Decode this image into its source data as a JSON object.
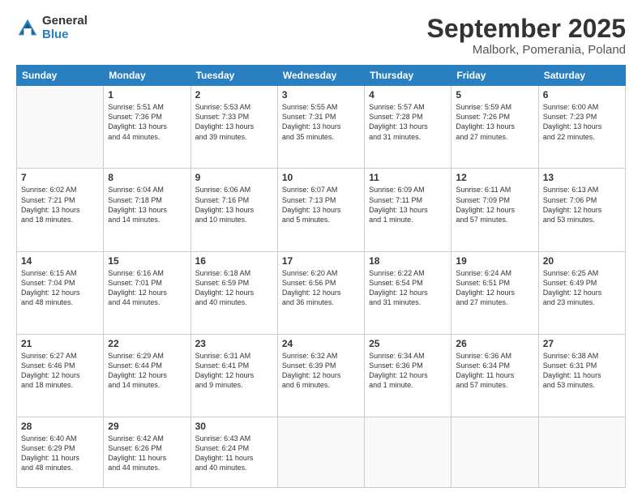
{
  "logo": {
    "general": "General",
    "blue": "Blue"
  },
  "header": {
    "month": "September 2025",
    "location": "Malbork, Pomerania, Poland"
  },
  "weekdays": [
    "Sunday",
    "Monday",
    "Tuesday",
    "Wednesday",
    "Thursday",
    "Friday",
    "Saturday"
  ],
  "weeks": [
    [
      {
        "day": "",
        "info": ""
      },
      {
        "day": "1",
        "info": "Sunrise: 5:51 AM\nSunset: 7:36 PM\nDaylight: 13 hours\nand 44 minutes."
      },
      {
        "day": "2",
        "info": "Sunrise: 5:53 AM\nSunset: 7:33 PM\nDaylight: 13 hours\nand 39 minutes."
      },
      {
        "day": "3",
        "info": "Sunrise: 5:55 AM\nSunset: 7:31 PM\nDaylight: 13 hours\nand 35 minutes."
      },
      {
        "day": "4",
        "info": "Sunrise: 5:57 AM\nSunset: 7:28 PM\nDaylight: 13 hours\nand 31 minutes."
      },
      {
        "day": "5",
        "info": "Sunrise: 5:59 AM\nSunset: 7:26 PM\nDaylight: 13 hours\nand 27 minutes."
      },
      {
        "day": "6",
        "info": "Sunrise: 6:00 AM\nSunset: 7:23 PM\nDaylight: 13 hours\nand 22 minutes."
      }
    ],
    [
      {
        "day": "7",
        "info": "Sunrise: 6:02 AM\nSunset: 7:21 PM\nDaylight: 13 hours\nand 18 minutes."
      },
      {
        "day": "8",
        "info": "Sunrise: 6:04 AM\nSunset: 7:18 PM\nDaylight: 13 hours\nand 14 minutes."
      },
      {
        "day": "9",
        "info": "Sunrise: 6:06 AM\nSunset: 7:16 PM\nDaylight: 13 hours\nand 10 minutes."
      },
      {
        "day": "10",
        "info": "Sunrise: 6:07 AM\nSunset: 7:13 PM\nDaylight: 13 hours\nand 5 minutes."
      },
      {
        "day": "11",
        "info": "Sunrise: 6:09 AM\nSunset: 7:11 PM\nDaylight: 13 hours\nand 1 minute."
      },
      {
        "day": "12",
        "info": "Sunrise: 6:11 AM\nSunset: 7:09 PM\nDaylight: 12 hours\nand 57 minutes."
      },
      {
        "day": "13",
        "info": "Sunrise: 6:13 AM\nSunset: 7:06 PM\nDaylight: 12 hours\nand 53 minutes."
      }
    ],
    [
      {
        "day": "14",
        "info": "Sunrise: 6:15 AM\nSunset: 7:04 PM\nDaylight: 12 hours\nand 48 minutes."
      },
      {
        "day": "15",
        "info": "Sunrise: 6:16 AM\nSunset: 7:01 PM\nDaylight: 12 hours\nand 44 minutes."
      },
      {
        "day": "16",
        "info": "Sunrise: 6:18 AM\nSunset: 6:59 PM\nDaylight: 12 hours\nand 40 minutes."
      },
      {
        "day": "17",
        "info": "Sunrise: 6:20 AM\nSunset: 6:56 PM\nDaylight: 12 hours\nand 36 minutes."
      },
      {
        "day": "18",
        "info": "Sunrise: 6:22 AM\nSunset: 6:54 PM\nDaylight: 12 hours\nand 31 minutes."
      },
      {
        "day": "19",
        "info": "Sunrise: 6:24 AM\nSunset: 6:51 PM\nDaylight: 12 hours\nand 27 minutes."
      },
      {
        "day": "20",
        "info": "Sunrise: 6:25 AM\nSunset: 6:49 PM\nDaylight: 12 hours\nand 23 minutes."
      }
    ],
    [
      {
        "day": "21",
        "info": "Sunrise: 6:27 AM\nSunset: 6:46 PM\nDaylight: 12 hours\nand 18 minutes."
      },
      {
        "day": "22",
        "info": "Sunrise: 6:29 AM\nSunset: 6:44 PM\nDaylight: 12 hours\nand 14 minutes."
      },
      {
        "day": "23",
        "info": "Sunrise: 6:31 AM\nSunset: 6:41 PM\nDaylight: 12 hours\nand 9 minutes."
      },
      {
        "day": "24",
        "info": "Sunrise: 6:32 AM\nSunset: 6:39 PM\nDaylight: 12 hours\nand 6 minutes."
      },
      {
        "day": "25",
        "info": "Sunrise: 6:34 AM\nSunset: 6:36 PM\nDaylight: 12 hours\nand 1 minute."
      },
      {
        "day": "26",
        "info": "Sunrise: 6:36 AM\nSunset: 6:34 PM\nDaylight: 11 hours\nand 57 minutes."
      },
      {
        "day": "27",
        "info": "Sunrise: 6:38 AM\nSunset: 6:31 PM\nDaylight: 11 hours\nand 53 minutes."
      }
    ],
    [
      {
        "day": "28",
        "info": "Sunrise: 6:40 AM\nSunset: 6:29 PM\nDaylight: 11 hours\nand 48 minutes."
      },
      {
        "day": "29",
        "info": "Sunrise: 6:42 AM\nSunset: 6:26 PM\nDaylight: 11 hours\nand 44 minutes."
      },
      {
        "day": "30",
        "info": "Sunrise: 6:43 AM\nSunset: 6:24 PM\nDaylight: 11 hours\nand 40 minutes."
      },
      {
        "day": "",
        "info": ""
      },
      {
        "day": "",
        "info": ""
      },
      {
        "day": "",
        "info": ""
      },
      {
        "day": "",
        "info": ""
      }
    ]
  ]
}
